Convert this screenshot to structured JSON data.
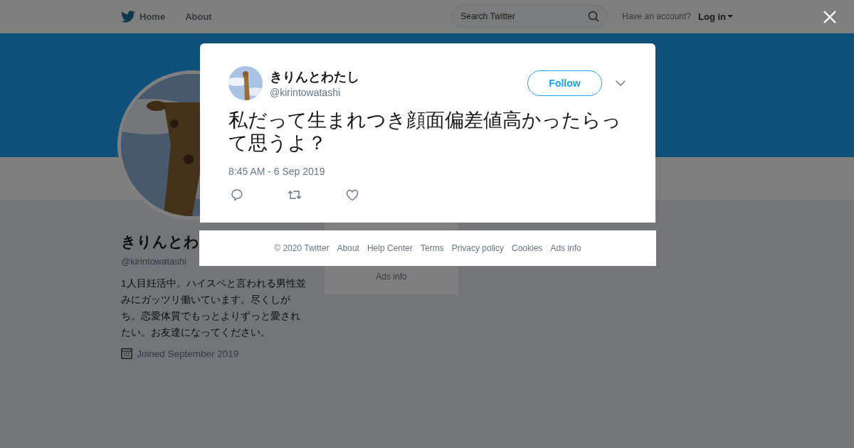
{
  "nav": {
    "items": [
      {
        "label": "Home"
      },
      {
        "label": "About"
      }
    ],
    "search": {
      "placeholder": "Search Twitter"
    },
    "account_prompt": "Have an account?",
    "login": "Log in"
  },
  "profile": {
    "name": "きりんとわ",
    "handle": "@kirintowatashi",
    "bio": "1人目妊活中。ハイスペと言われる男性並みにガッツリ働いています。尽くしがち。恋愛体質でもっとよりずっと愛されたい。お友達になってください。",
    "joined": "Joined September 2019"
  },
  "sidebar_card": {
    "link": "Ads info"
  },
  "tweet": {
    "name": "きりんとわたし",
    "handle": "@kirintowatashi",
    "follow": "Follow",
    "text": "私だって生まれつき顔面偏差値高かったらって思うよ？",
    "time": "8:45 AM - 6 Sep 2019"
  },
  "footer": [
    "© 2020 Twitter",
    "About",
    "Help Center",
    "Terms",
    "Privacy policy",
    "Cookies",
    "Ads info"
  ]
}
